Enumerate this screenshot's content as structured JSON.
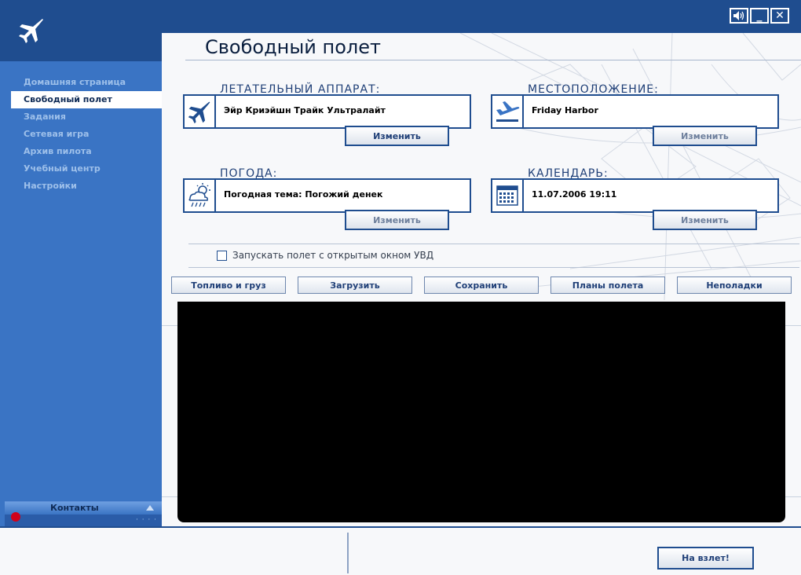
{
  "window": {
    "sound_icon": "speaker-icon",
    "minimize_label": "_",
    "close_label": "✕"
  },
  "sidebar": {
    "items": [
      {
        "label": "Домашняя страница",
        "active": false
      },
      {
        "label": "Свободный полет",
        "active": true
      },
      {
        "label": "Задания",
        "active": false
      },
      {
        "label": "Сетевая игра",
        "active": false
      },
      {
        "label": "Архив пилота",
        "active": false
      },
      {
        "label": "Учебный центр",
        "active": false
      },
      {
        "label": "Настройки",
        "active": false
      }
    ],
    "contacts_label": "Контакты",
    "contacts_dots": "· · · ·"
  },
  "main": {
    "title": "Свободный полет",
    "aircraft": {
      "label": "ЛЕТАТЕЛЬНЫЙ АППАРАТ:",
      "value": "Эйр Криэйшн Трайк Ультралайт",
      "button": "Изменить"
    },
    "location": {
      "label": "МЕСТОПОЛОЖЕНИЕ:",
      "value": "Friday Harbor",
      "button": "Изменить"
    },
    "weather": {
      "label": "ПОГОДА:",
      "value": "Погодная тема: Погожий денек",
      "button": "Изменить"
    },
    "calendar": {
      "label": "КАЛЕНДАРЬ:",
      "value": "11.07.2006 19:11",
      "button": "Изменить"
    },
    "uvd_checkbox_label": "Запускать полет с открытым окном УВД",
    "uvd_checked": false,
    "tools": [
      "Топливо и груз",
      "Загрузить",
      "Сохранить",
      "Планы полета",
      "Неполадки"
    ]
  },
  "bottom": {
    "takeoff_label": "На взлет!"
  },
  "colors": {
    "dark_blue": "#1f4d8f",
    "sidebar_blue": "#3a74c4",
    "nav_text": "#9ec0ea",
    "accent_red": "#d0021b"
  }
}
